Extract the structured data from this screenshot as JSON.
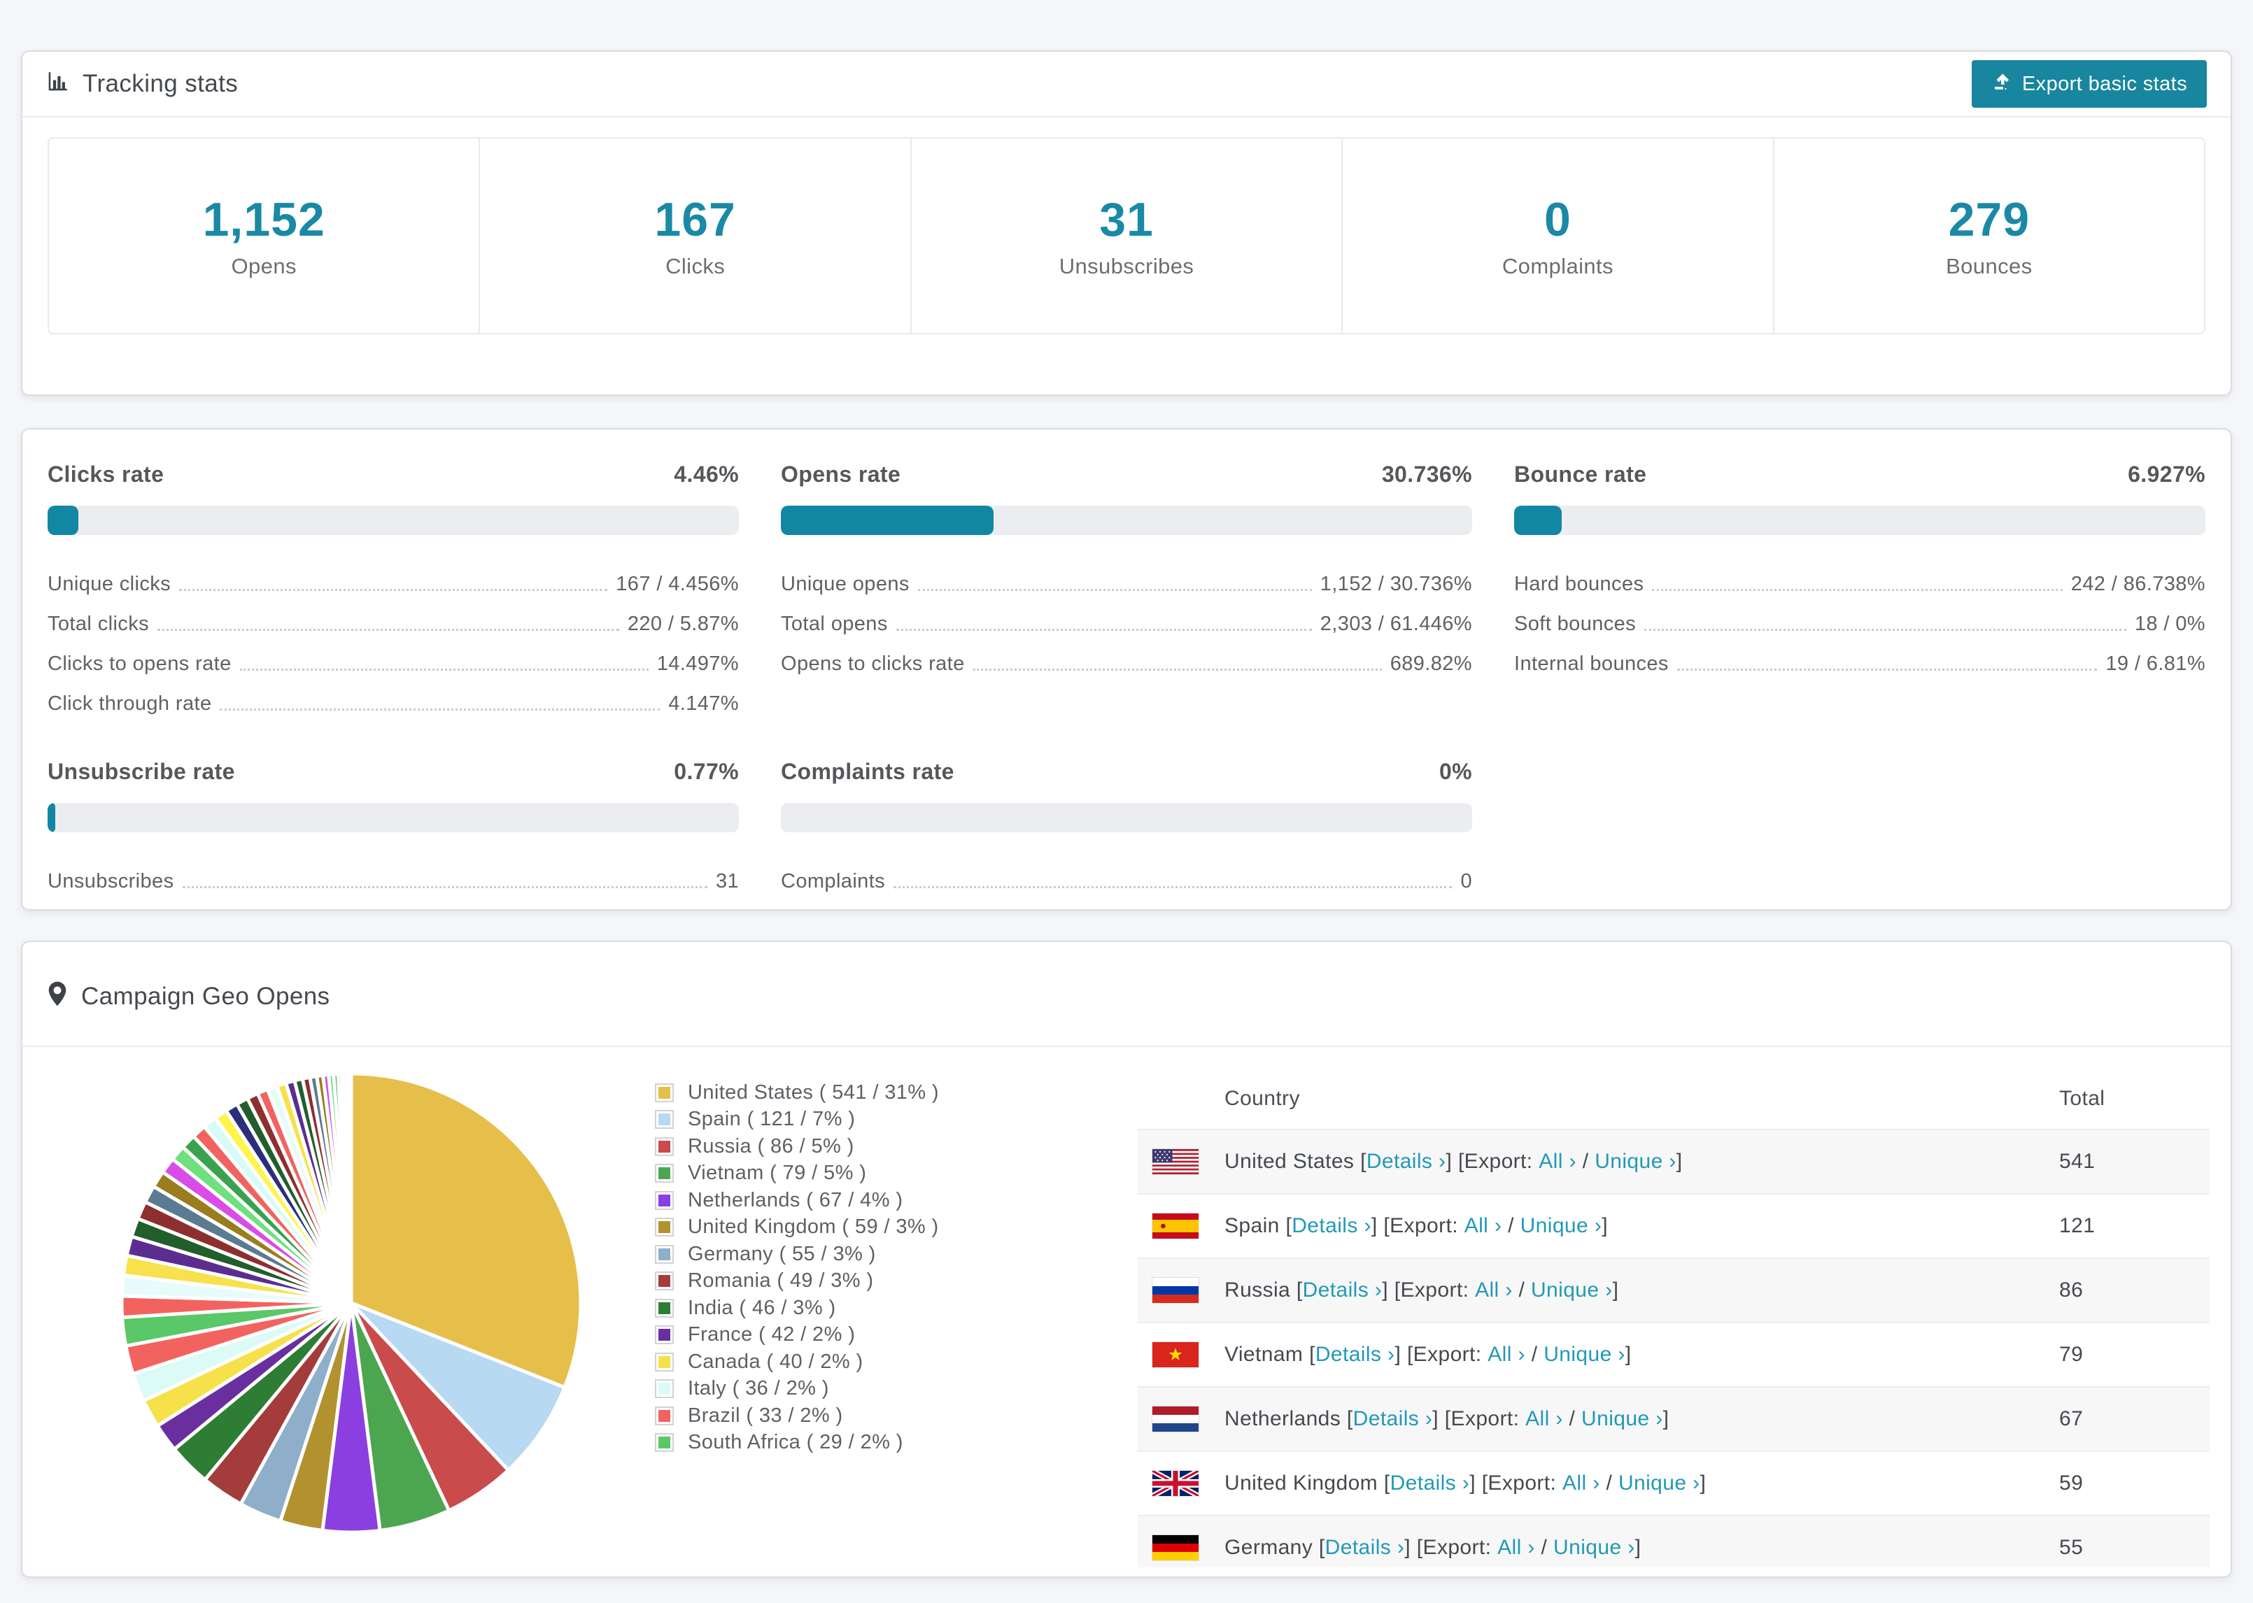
{
  "accent_color": "#1287A3",
  "link_color": "#2299B6",
  "tracking": {
    "title": "Tracking stats",
    "export_button": "Export basic stats",
    "stats": [
      {
        "value": "1,152",
        "label": "Opens"
      },
      {
        "value": "167",
        "label": "Clicks"
      },
      {
        "value": "31",
        "label": "Unsubscribes"
      },
      {
        "value": "0",
        "label": "Complaints"
      },
      {
        "value": "279",
        "label": "Bounces"
      }
    ]
  },
  "rates": {
    "blocks": [
      {
        "title": "Clicks rate",
        "percent": "4.46%",
        "bar_fill": 4.46,
        "rows": [
          {
            "label": "Unique clicks",
            "value": "167 / 4.456%"
          },
          {
            "label": "Total clicks",
            "value": "220 / 5.87%"
          },
          {
            "label": "Clicks to opens rate",
            "value": "14.497%"
          },
          {
            "label": "Click through rate",
            "value": "4.147%"
          }
        ]
      },
      {
        "title": "Opens rate",
        "percent": "30.736%",
        "bar_fill": 30.736,
        "rows": [
          {
            "label": "Unique opens",
            "value": "1,152 / 30.736%"
          },
          {
            "label": "Total opens",
            "value": "2,303 / 61.446%"
          },
          {
            "label": "Opens to clicks rate",
            "value": "689.82%"
          }
        ]
      },
      {
        "title": "Bounce rate",
        "percent": "6.927%",
        "bar_fill": 6.927,
        "rows": [
          {
            "label": "Hard bounces",
            "value": "242 / 86.738%"
          },
          {
            "label": "Soft bounces",
            "value": "18 / 0%"
          },
          {
            "label": "Internal bounces",
            "value": "19 / 6.81%"
          }
        ]
      },
      {
        "title": "Unsubscribe rate",
        "percent": "0.77%",
        "bar_fill": 0.77,
        "rows": [
          {
            "label": "Unsubscribes",
            "value": "31"
          }
        ]
      },
      {
        "title": "Complaints rate",
        "percent": "0%",
        "bar_fill": 0,
        "rows": [
          {
            "label": "Complaints",
            "value": "0"
          }
        ]
      }
    ]
  },
  "geo": {
    "title": "Campaign Geo Opens",
    "legend": [
      {
        "text": "United States ( 541 / 31% )",
        "color": "#E6BE4A"
      },
      {
        "text": "Spain ( 121 / 7% )",
        "color": "#B7D9F1"
      },
      {
        "text": "Russia ( 86 / 5% )",
        "color": "#C94B4B"
      },
      {
        "text": "Vietnam ( 79 / 5% )",
        "color": "#4CA64F"
      },
      {
        "text": "Netherlands ( 67 / 4% )",
        "color": "#8B3FE0"
      },
      {
        "text": "United Kingdom ( 59 / 3% )",
        "color": "#B2922F"
      },
      {
        "text": "Germany ( 55 / 3% )",
        "color": "#8FAEC9"
      },
      {
        "text": "Romania ( 49 / 3% )",
        "color": "#A43C3C"
      },
      {
        "text": "India ( 46 / 3% )",
        "color": "#2E7D35"
      },
      {
        "text": "France ( 42 / 2% )",
        "color": "#6A2F9E"
      },
      {
        "text": "Canada ( 40 / 2% )",
        "color": "#F6E14B"
      },
      {
        "text": "Italy ( 36 / 2% )",
        "color": "#DCFBF6"
      },
      {
        "text": "Brazil ( 33 / 2% )",
        "color": "#F2635F"
      },
      {
        "text": "South Africa ( 29 / 2% )",
        "color": "#5AC768"
      }
    ],
    "table": {
      "headers": {
        "country": "Country",
        "total": "Total"
      },
      "labels": {
        "bracket_open": "[",
        "bracket_close": "]",
        "details": "Details ›",
        "export_prefix": "[Export:",
        "all": "All ›",
        "slash": "/",
        "unique": "Unique ›"
      },
      "rows": [
        {
          "country": "United States",
          "total": "541"
        },
        {
          "country": "Spain",
          "total": "121"
        },
        {
          "country": "Russia",
          "total": "86"
        },
        {
          "country": "Vietnam",
          "total": "79"
        },
        {
          "country": "Netherlands",
          "total": "67"
        },
        {
          "country": "United Kingdom",
          "total": "59"
        },
        {
          "country": "Germany",
          "total": "55"
        }
      ]
    }
  },
  "chart_data": {
    "type": "pie",
    "title": "Campaign Geo Opens",
    "unit": "opens",
    "start_angle_deg": -90,
    "direction": "clockwise",
    "legend_position": "right",
    "slices": [
      {
        "label": "United States",
        "count": 541,
        "pct": 31,
        "color": "#E6BE4A"
      },
      {
        "label": "Spain",
        "count": 121,
        "pct": 7,
        "color": "#B7D9F1"
      },
      {
        "label": "Russia",
        "count": 86,
        "pct": 5,
        "color": "#C94B4B"
      },
      {
        "label": "Vietnam",
        "count": 79,
        "pct": 5,
        "color": "#4CA64F"
      },
      {
        "label": "Netherlands",
        "count": 67,
        "pct": 4,
        "color": "#8B3FE0"
      },
      {
        "label": "United Kingdom",
        "count": 59,
        "pct": 3,
        "color": "#B2922F"
      },
      {
        "label": "Germany",
        "count": 55,
        "pct": 3,
        "color": "#8FAEC9"
      },
      {
        "label": "Romania",
        "count": 49,
        "pct": 3,
        "color": "#A43C3C"
      },
      {
        "label": "India",
        "count": 46,
        "pct": 3,
        "color": "#2E7D35"
      },
      {
        "label": "France",
        "count": 42,
        "pct": 2,
        "color": "#6A2F9E"
      },
      {
        "label": "Canada",
        "count": 40,
        "pct": 2,
        "color": "#F6E14B"
      },
      {
        "label": "Italy",
        "count": 36,
        "pct": 2,
        "color": "#DCFBF6"
      },
      {
        "label": "Brazil",
        "count": 33,
        "pct": 2,
        "color": "#F2635F"
      },
      {
        "label": "South Africa",
        "count": 29,
        "pct": 2,
        "color": "#5AC768"
      }
    ],
    "other": {
      "note": "long tail of smaller countries rendered as decreasing slivers",
      "pct": 26,
      "slice_count": 34,
      "palette": [
        "#F2635F",
        "#E7FBFB",
        "#F7E14C",
        "#5B2D90",
        "#225E2B",
        "#8E2F2F",
        "#5B7B93",
        "#9A7D1E",
        "#D94CE8",
        "#6FE07F",
        "#3AA24F",
        "#F2635F",
        "#D9FBF7",
        "#FDF54E",
        "#2B2E7B",
        "#225E2B",
        "#8E2F2F"
      ]
    }
  }
}
